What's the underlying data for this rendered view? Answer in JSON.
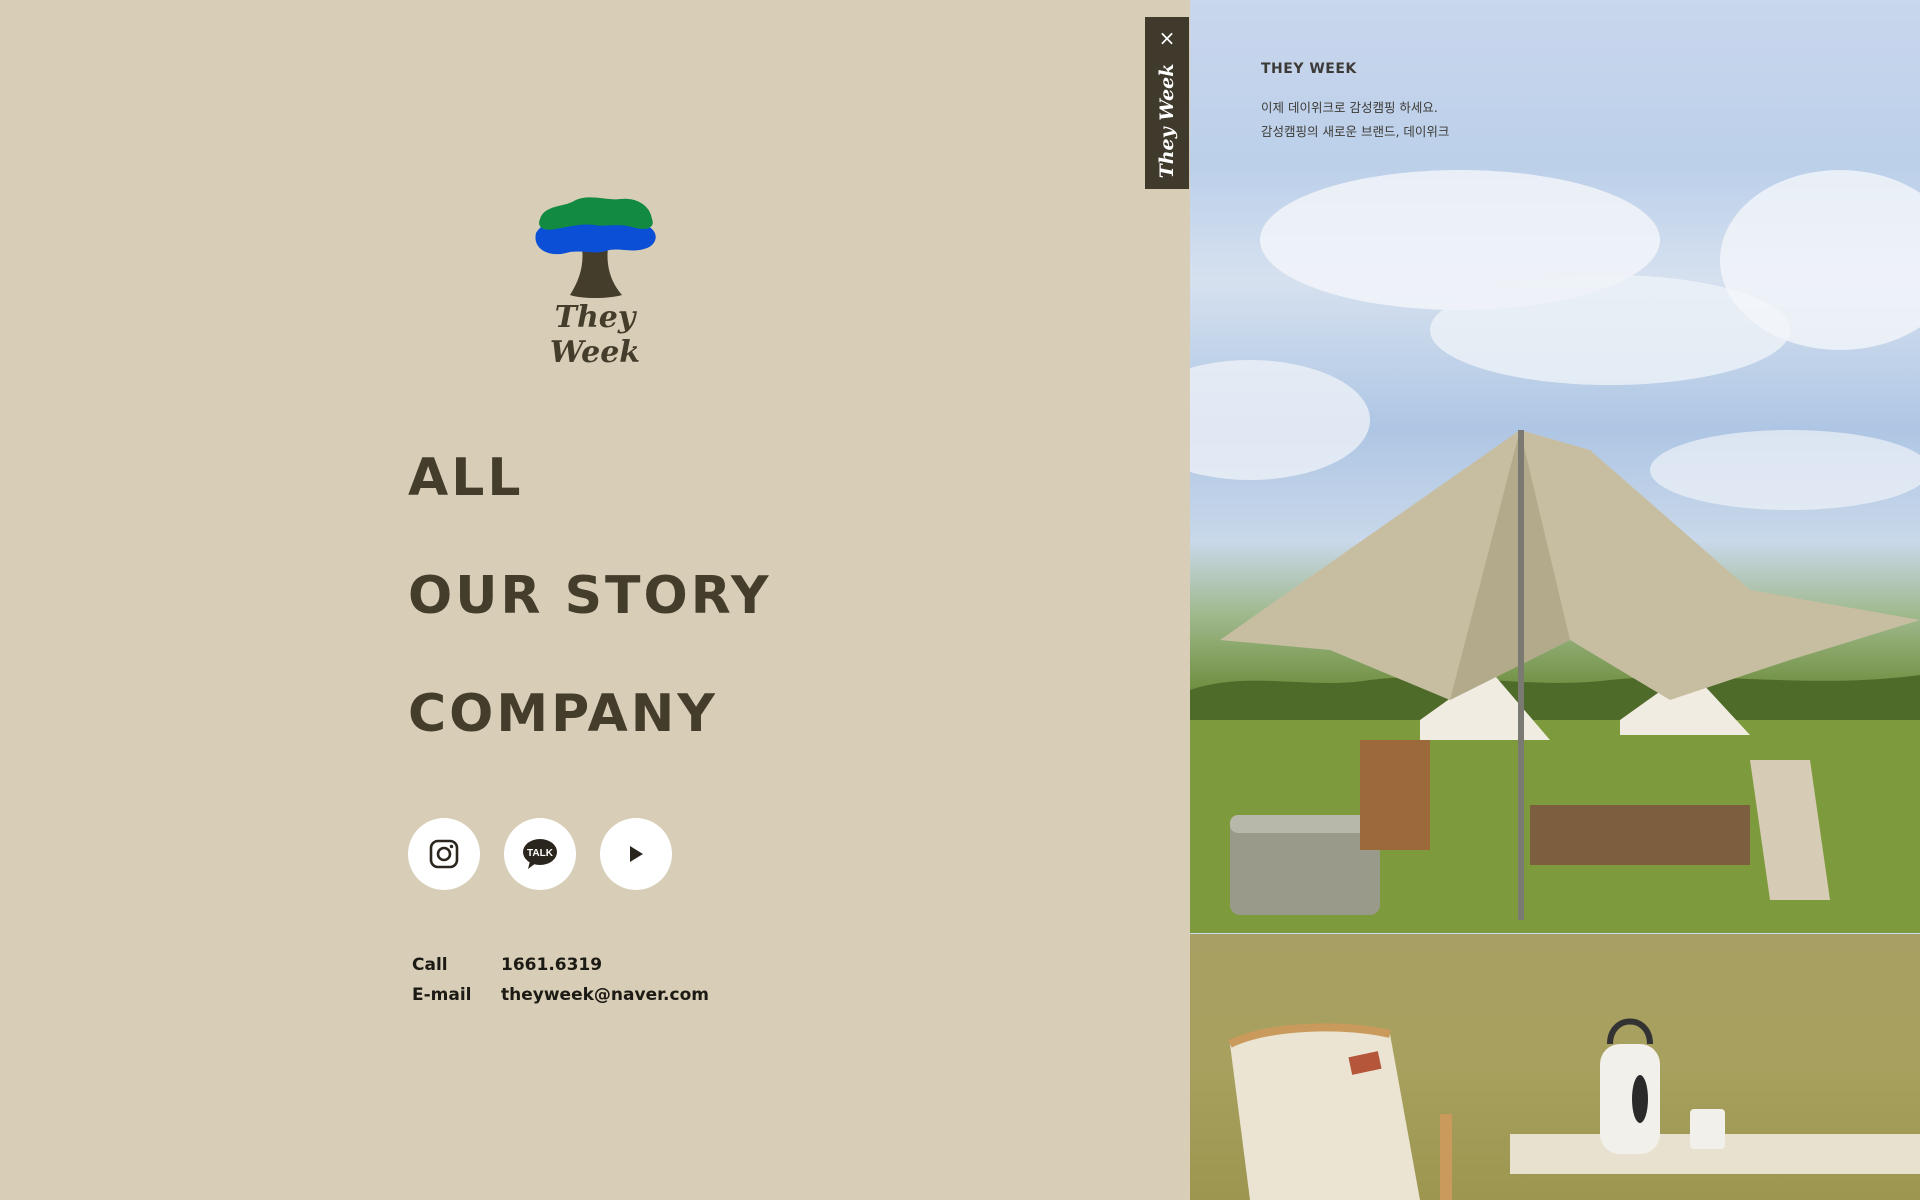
{
  "brand": {
    "logo_text": "They Week",
    "colors": {
      "tree_top": "#138a42",
      "tree_mid": "#0a4fd6",
      "trunk": "#453d2c"
    }
  },
  "menu": {
    "items": [
      {
        "label": "ALL"
      },
      {
        "label": "OUR STORY"
      },
      {
        "label": "COMPANY"
      }
    ]
  },
  "socials": [
    {
      "icon": "instagram-icon"
    },
    {
      "icon": "kakaotalk-icon",
      "badge": "TALK"
    },
    {
      "icon": "youtube-play-icon"
    }
  ],
  "contact": {
    "call_label": "Call",
    "call_value": "1661.6319",
    "email_label": "E-mail",
    "email_value": "theyweek@naver.com"
  },
  "tab": {
    "close_glyph": "×",
    "label": "They Week"
  },
  "right": {
    "brand": "THEY WEEK",
    "line1": "이제 데이위크로 감성캠핑 하세요.",
    "line2": "감성캠핑의 새로운 브랜드, 데이위크"
  },
  "theme": {
    "background": "#d8ceb7",
    "text": "#453d2c",
    "tab_bg": "#3f3a2c"
  }
}
